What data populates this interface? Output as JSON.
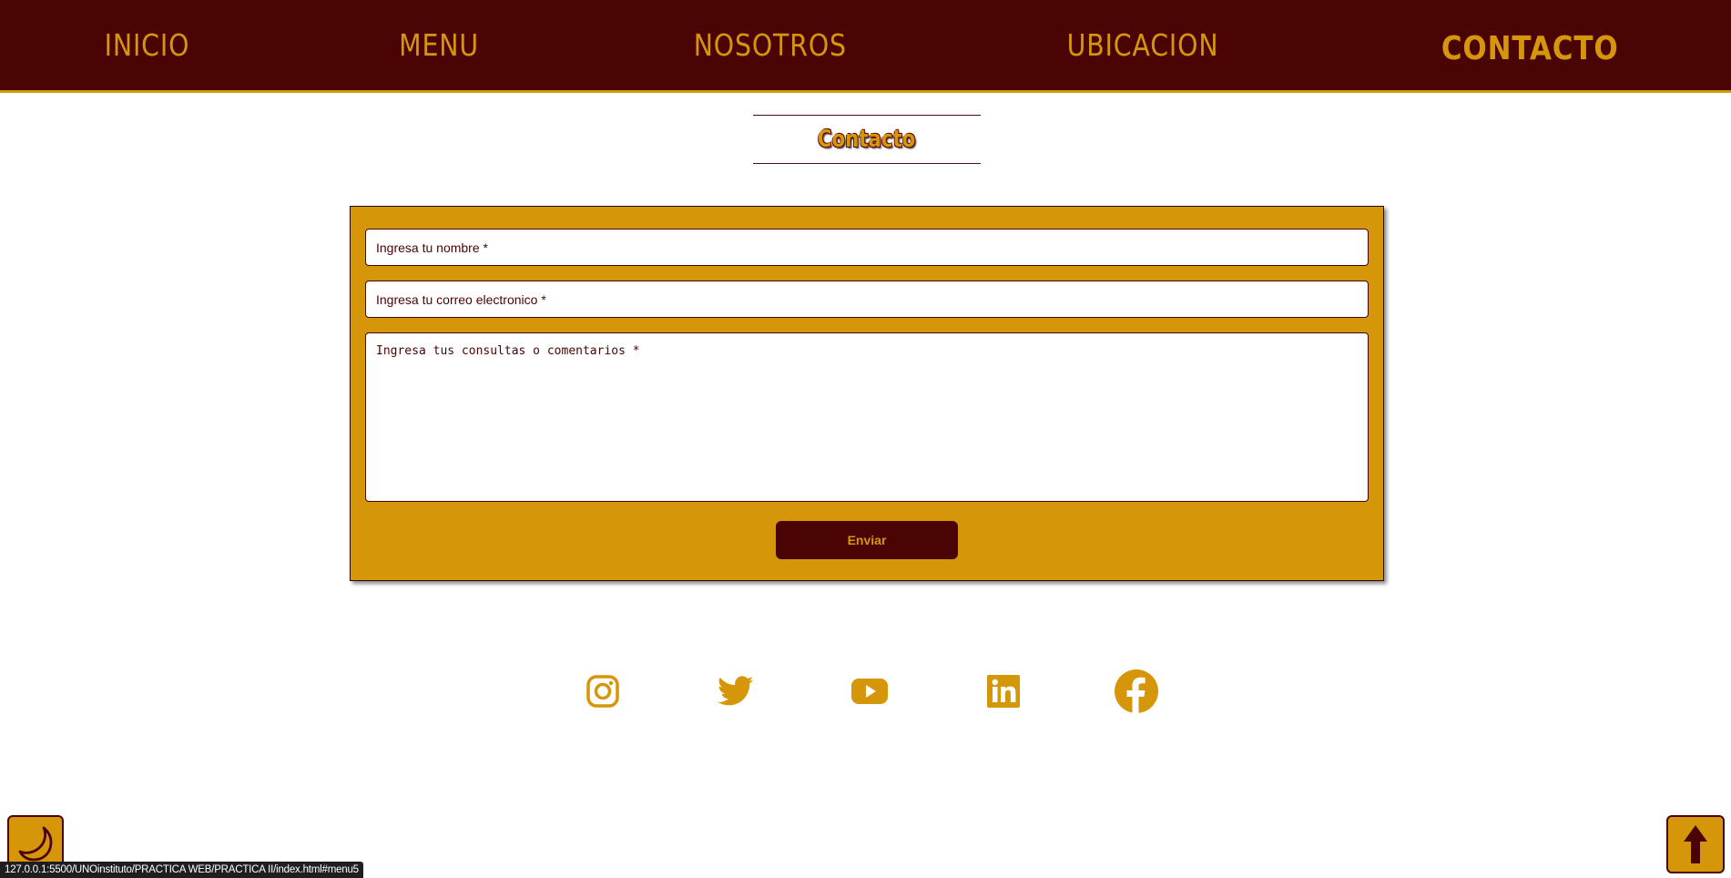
{
  "nav": {
    "items": [
      {
        "label": "INICIO"
      },
      {
        "label": "MENU"
      },
      {
        "label": "NOSOTROS"
      },
      {
        "label": "UBICACION"
      },
      {
        "label": "CONTACTO"
      }
    ],
    "active": "CONTACTO"
  },
  "section": {
    "title": "Contacto"
  },
  "form": {
    "name_placeholder": "Ingresa tu nombre *",
    "email_placeholder": "Ingresa tu correo electronico *",
    "message_placeholder": "Ingresa tus consultas o comentarios *",
    "submit_label": "Enviar"
  },
  "social": {
    "icons": [
      "instagram-icon",
      "twitter-icon",
      "youtube-icon",
      "linkedin-icon",
      "facebook-icon"
    ]
  },
  "controls": {
    "theme_toggle_icon": "moon-icon",
    "scroll_top_icon": "arrow-up-icon"
  },
  "status_bar": {
    "url": "127.0.0.1:5500/UNOinstituto/PRACTICA WEB/PRACTICA II/index.html#menu5"
  },
  "colors": {
    "primary": "#4a0404",
    "accent": "#d6960a",
    "background": "#ffffff"
  }
}
